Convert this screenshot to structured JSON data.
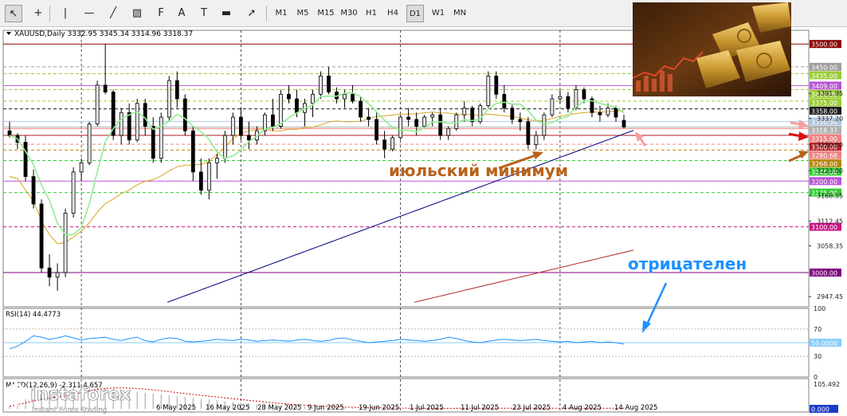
{
  "toolbar": {
    "timeframes": [
      "M1",
      "M5",
      "M15",
      "M30",
      "H1",
      "H4",
      "D1",
      "W1",
      "MN"
    ],
    "selected_timeframe": "D1",
    "tools": [
      "cursor-icon",
      "crosshair-icon",
      "vertical-line-icon",
      "horizontal-line-icon",
      "trendline-icon",
      "channel-icon",
      "fibonacci-icon",
      "text-icon",
      "label-icon",
      "shapes-icon",
      "arrow-icon"
    ]
  },
  "header": {
    "symbol_line": "XAUUSD,Daily  3332.95 3345.34 3314.96 3318.37"
  },
  "annotations": {
    "july_low": "июльский минимум",
    "negative": "отрицателен"
  },
  "logo": {
    "brand": "instaforex",
    "tagline": "Instant Forex Trading"
  },
  "colors": {
    "bull": "#e6e6e6",
    "bear": "#000000",
    "ma_fast": "#90ee90",
    "ma_mid": "#daa520",
    "ma_slow": "#000080",
    "ma_long": "#b22222",
    "rsi": "#1e90ff",
    "annotation_brown": "#b8621b",
    "annotation_blue": "#1e90ff"
  },
  "chart_data": [
    {
      "type": "candlestick",
      "symbol": "XAUUSD",
      "timeframe": "Daily",
      "ylim": [
        2925,
        3530
      ],
      "x_labels": [
        "6 May 2025",
        "16 May 2025",
        "28 May 2025",
        "9 Jun 2025",
        "19 Jun 2025",
        "1 Jul 2025",
        "11 Jul 2025",
        "23 Jul 2025",
        "4 Aug 2025",
        "14 Aug 2025"
      ],
      "y_ticks": [
        "3391.95",
        "3337.20",
        "3280.00",
        "3223.00",
        "3168.55",
        "3112.45",
        "3058.35",
        "2947.45"
      ],
      "level_labels": [
        {
          "value": 3500,
          "label": "3500.00",
          "color": "#8b0000",
          "line": "solid"
        },
        {
          "value": 3450,
          "label": "3450.00",
          "color": "#9e9e9e",
          "line": "dashed"
        },
        {
          "value": 3435,
          "label": "3435.00",
          "color": "#9acd32",
          "line": "dashed"
        },
        {
          "value": 3409,
          "label": "3409.00",
          "color": "#ba55d3",
          "line": "solid"
        },
        {
          "value": 3400,
          "label": "3400.00",
          "color": "#9acd32",
          "line": "dashed"
        },
        {
          "value": 3375,
          "label": "3375.00",
          "color": "#9acd32",
          "line": "dashed"
        },
        {
          "value": 3358,
          "label": "3358.00",
          "color": "#1c1c1c",
          "line": "dashed"
        },
        {
          "value": 3330.5,
          "label": "3330.50",
          "color": "#b0c4de",
          "line": "solid"
        },
        {
          "value": 3318.37,
          "label": "3318.37",
          "color": "#b0b0b0",
          "line": "solid"
        },
        {
          "value": 3315,
          "label": "3315.00",
          "color": "#f08080",
          "line": "solid"
        },
        {
          "value": 3300,
          "label": "3300.00",
          "color": "#b22222",
          "line": "solid"
        },
        {
          "value": 3280.68,
          "label": "3280.68",
          "color": "#f08080",
          "line": "dashed"
        },
        {
          "value": 3268,
          "label": "3268.00",
          "color": "#b8860b",
          "line": "dashed"
        },
        {
          "value": 3245,
          "label": "3245.00",
          "color": "#32cd32",
          "line": "dashed"
        },
        {
          "value": 3200,
          "label": "3200.00",
          "color": "#ba55d3",
          "line": "solid"
        },
        {
          "value": 3175,
          "label": "3175.00",
          "color": "#32cd32",
          "line": "dashed"
        },
        {
          "value": 3100,
          "label": "3100.00",
          "color": "#c71585",
          "line": "dashed"
        },
        {
          "value": 3000,
          "label": "3000.00",
          "color": "#800080",
          "line": "solid"
        }
      ],
      "candles": [
        [
          3310,
          3330,
          3295,
          3300
        ],
        [
          3300,
          3305,
          3270,
          3285
        ],
        [
          3285,
          3300,
          3200,
          3210
        ],
        [
          3210,
          3225,
          3140,
          3150
        ],
        [
          3150,
          3160,
          3000,
          3010
        ],
        [
          3010,
          3040,
          2970,
          2990
        ],
        [
          2990,
          3020,
          2960,
          3000
        ],
        [
          3000,
          3140,
          2990,
          3130
        ],
        [
          3130,
          3230,
          3120,
          3220
        ],
        [
          3220,
          3250,
          3200,
          3240
        ],
        [
          3240,
          3330,
          3235,
          3325
        ],
        [
          3325,
          3420,
          3320,
          3410
        ],
        [
          3410,
          3500,
          3390,
          3395
        ],
        [
          3395,
          3400,
          3290,
          3300
        ],
        [
          3300,
          3360,
          3280,
          3350
        ],
        [
          3350,
          3370,
          3280,
          3290
        ],
        [
          3290,
          3380,
          3285,
          3370
        ],
        [
          3370,
          3380,
          3300,
          3320
        ],
        [
          3320,
          3340,
          3240,
          3250
        ],
        [
          3250,
          3350,
          3240,
          3340
        ],
        [
          3340,
          3430,
          3330,
          3420
        ],
        [
          3420,
          3440,
          3360,
          3380
        ],
        [
          3380,
          3390,
          3300,
          3310
        ],
        [
          3310,
          3320,
          3200,
          3220
        ],
        [
          3220,
          3250,
          3170,
          3180
        ],
        [
          3180,
          3250,
          3160,
          3240
        ],
        [
          3240,
          3260,
          3205,
          3250
        ],
        [
          3250,
          3310,
          3240,
          3300
        ],
        [
          3300,
          3350,
          3280,
          3340
        ],
        [
          3340,
          3360,
          3290,
          3300
        ],
        [
          3300,
          3330,
          3270,
          3290
        ],
        [
          3290,
          3320,
          3280,
          3310
        ],
        [
          3310,
          3350,
          3300,
          3345
        ],
        [
          3345,
          3380,
          3310,
          3320
        ],
        [
          3320,
          3400,
          3315,
          3390
        ],
        [
          3390,
          3410,
          3370,
          3380
        ],
        [
          3380,
          3400,
          3340,
          3350
        ],
        [
          3350,
          3380,
          3320,
          3370
        ],
        [
          3370,
          3400,
          3340,
          3390
        ],
        [
          3390,
          3440,
          3380,
          3430
        ],
        [
          3430,
          3450,
          3390,
          3395
        ],
        [
          3395,
          3405,
          3370,
          3380
        ],
        [
          3380,
          3400,
          3360,
          3390
        ],
        [
          3390,
          3410,
          3370,
          3375
        ],
        [
          3375,
          3385,
          3330,
          3340
        ],
        [
          3340,
          3360,
          3320,
          3335
        ],
        [
          3335,
          3350,
          3280,
          3290
        ],
        [
          3290,
          3310,
          3250,
          3270
        ],
        [
          3270,
          3300,
          3265,
          3295
        ],
        [
          3295,
          3345,
          3290,
          3340
        ],
        [
          3340,
          3360,
          3320,
          3335
        ],
        [
          3335,
          3350,
          3300,
          3320
        ],
        [
          3320,
          3345,
          3315,
          3340
        ],
        [
          3340,
          3350,
          3320,
          3345
        ],
        [
          3345,
          3360,
          3290,
          3300
        ],
        [
          3300,
          3320,
          3290,
          3315
        ],
        [
          3315,
          3350,
          3310,
          3345
        ],
        [
          3345,
          3375,
          3330,
          3360
        ],
        [
          3360,
          3365,
          3320,
          3330
        ],
        [
          3330,
          3370,
          3325,
          3365
        ],
        [
          3365,
          3440,
          3360,
          3430
        ],
        [
          3430,
          3440,
          3380,
          3390
        ],
        [
          3390,
          3410,
          3350,
          3360
        ],
        [
          3360,
          3370,
          3325,
          3335
        ],
        [
          3335,
          3350,
          3310,
          3330
        ],
        [
          3330,
          3340,
          3270,
          3280
        ],
        [
          3280,
          3310,
          3270,
          3300
        ],
        [
          3300,
          3350,
          3290,
          3345
        ],
        [
          3345,
          3390,
          3340,
          3380
        ],
        [
          3380,
          3400,
          3370,
          3385
        ],
        [
          3385,
          3395,
          3350,
          3360
        ],
        [
          3360,
          3410,
          3355,
          3400
        ],
        [
          3400,
          3405,
          3370,
          3380
        ],
        [
          3380,
          3385,
          3340,
          3350
        ],
        [
          3350,
          3365,
          3330,
          3345
        ],
        [
          3345,
          3370,
          3340,
          3360
        ],
        [
          3360,
          3365,
          3330,
          3340
        ],
        [
          3332.95,
          3345.34,
          3314.96,
          3318.37
        ]
      ]
    },
    {
      "type": "line",
      "indicator": "RSI(14)",
      "value": "44.4773",
      "ylim": [
        0,
        100
      ],
      "y_ticks": [
        "100",
        "70",
        "30",
        "0"
      ],
      "level_labels": [
        {
          "value": 50,
          "label": "50.0000"
        }
      ],
      "series": [
        {
          "values": [
            41,
            45,
            52,
            60,
            58,
            55,
            57,
            60,
            57,
            54,
            56,
            57,
            58,
            55,
            53,
            56,
            58,
            53,
            51,
            55,
            57,
            56,
            52,
            51,
            52,
            53,
            55,
            54,
            53,
            55,
            54,
            52,
            53,
            54,
            53,
            52,
            54,
            55,
            53,
            52,
            53,
            56,
            57,
            54,
            52,
            50,
            51,
            52,
            53,
            55,
            54,
            53,
            52,
            53,
            55,
            58,
            56,
            53,
            51,
            50,
            52,
            54,
            55,
            54,
            53,
            54,
            55,
            53,
            52,
            51,
            52,
            50,
            51,
            52,
            50,
            51,
            50,
            48
          ]
        }
      ]
    },
    {
      "type": "bar",
      "indicator": "MACD(12,26,9)",
      "value": "-2.311 4.657",
      "y_ticks": [
        "105.492",
        "0.000"
      ],
      "series": [
        {
          "values": [
            12,
            28,
            45,
            62,
            75,
            86,
            94,
            99,
            101,
            103,
            105,
            104,
            100,
            95,
            90,
            84,
            80,
            76,
            72,
            68,
            64,
            60,
            56,
            52,
            48,
            44,
            40,
            36,
            32,
            28,
            24,
            20,
            18,
            16,
            14,
            12,
            10,
            9,
            8,
            7,
            6,
            5,
            5,
            4,
            4,
            3,
            3,
            2,
            2,
            2,
            2,
            2,
            3,
            3,
            3,
            3,
            3,
            3,
            3,
            3,
            3,
            3,
            3,
            3,
            3,
            3,
            3,
            3,
            3,
            3,
            3,
            3,
            3,
            3,
            3,
            3,
            3,
            3
          ]
        }
      ]
    }
  ]
}
